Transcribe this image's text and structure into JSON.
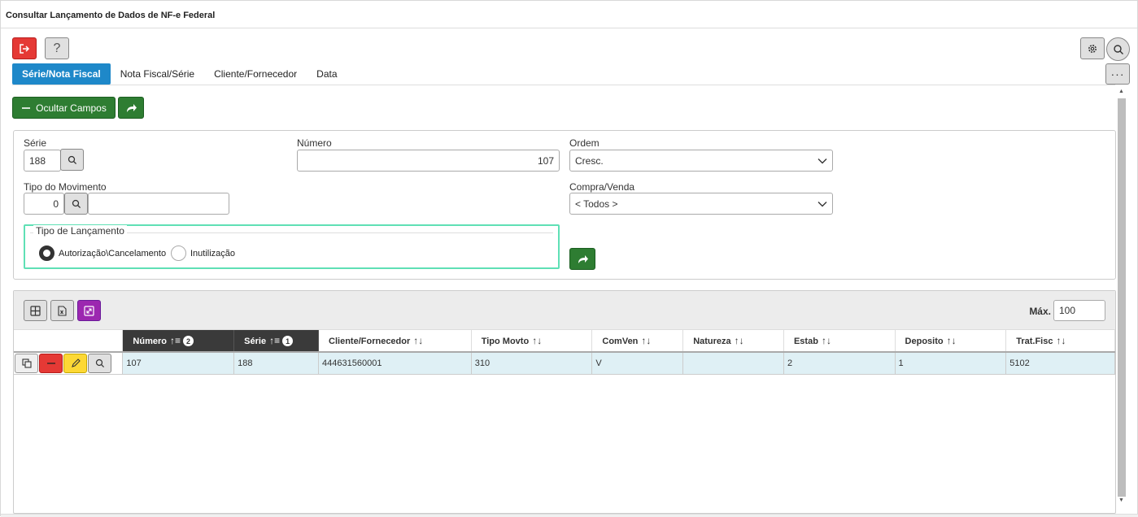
{
  "window": {
    "title": "Consultar Lançamento de Dados de NF-e Federal"
  },
  "toolbar": {
    "help_label": "?",
    "more_label": "···"
  },
  "tabs": [
    {
      "label": "Série/Nota Fiscal",
      "active": true
    },
    {
      "label": "Nota Fiscal/Série",
      "active": false
    },
    {
      "label": "Cliente/Fornecedor",
      "active": false
    },
    {
      "label": "Data",
      "active": false
    }
  ],
  "actions": {
    "hide_fields_label": "Ocultar Campos"
  },
  "form": {
    "serie": {
      "label": "Série",
      "value": "188"
    },
    "numero": {
      "label": "Número",
      "value": "107"
    },
    "ordem": {
      "label": "Ordem",
      "value": "Cresc."
    },
    "tipo_movimento": {
      "label": "Tipo do Movimento",
      "code": "0",
      "description": ""
    },
    "compra_venda": {
      "label": "Compra/Venda",
      "value": "< Todos >"
    },
    "tipo_lancamento": {
      "legend": "Tipo de Lançamento",
      "options": [
        {
          "label": "Autorização\\Cancelamento",
          "selected": true
        },
        {
          "label": "Inutilização",
          "selected": false
        }
      ]
    }
  },
  "grid": {
    "max_label": "Máx.",
    "max_value": "100",
    "columns": [
      {
        "label": "Número",
        "sorted": true,
        "order": "2"
      },
      {
        "label": "Série",
        "sorted": true,
        "order": "1"
      },
      {
        "label": "Cliente/Fornecedor",
        "sorted": false
      },
      {
        "label": "Tipo Movto",
        "sorted": false
      },
      {
        "label": "ComVen",
        "sorted": false
      },
      {
        "label": "Natureza",
        "sorted": false
      },
      {
        "label": "Estab",
        "sorted": false
      },
      {
        "label": "Deposito",
        "sorted": false
      },
      {
        "label": "Trat.Fisc",
        "sorted": false
      }
    ],
    "rows": [
      [
        "107",
        "188",
        "444631560001",
        "310",
        "V",
        "",
        "2",
        "1",
        "5102"
      ]
    ]
  },
  "colors": {
    "tab_active": "#1e88c9",
    "primary_green": "#2e7d32",
    "danger_red": "#e53935",
    "edit_yellow": "#fdd835",
    "expand_purple": "#9c27b0",
    "selected_row": "#dff0f5",
    "fieldset_border": "#5fe0b5"
  }
}
